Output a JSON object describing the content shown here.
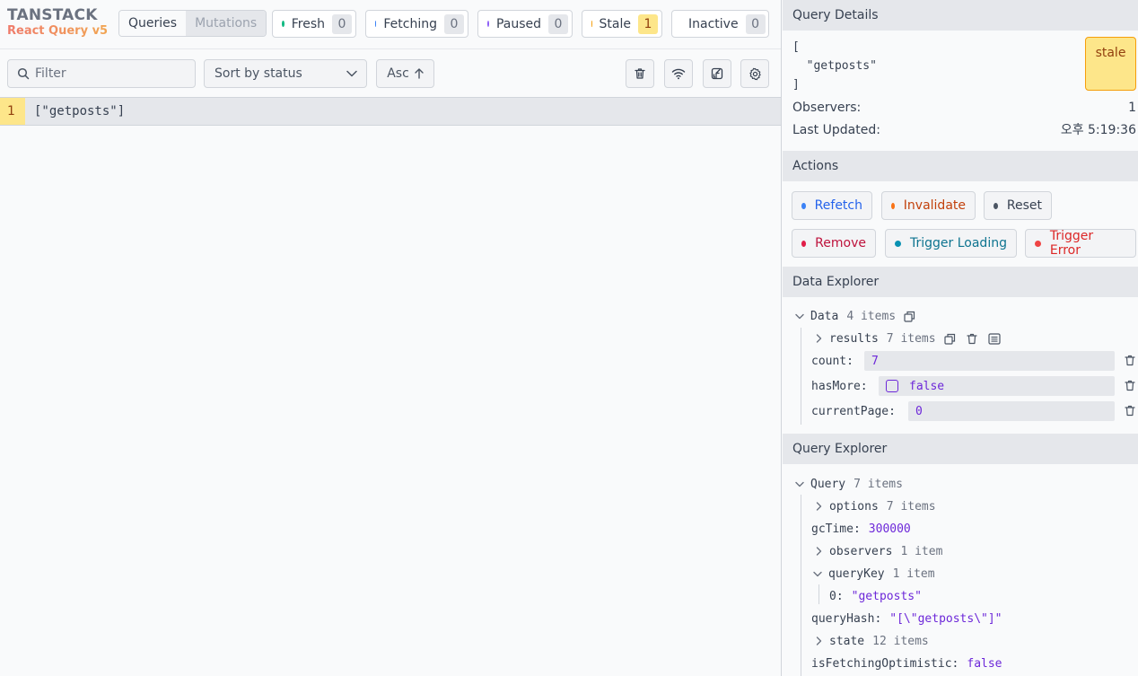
{
  "logo": {
    "line1": "TANSTACK",
    "line2": "React Query v5"
  },
  "tabs": {
    "queries": "Queries",
    "mutations": "Mutations"
  },
  "status_counts": [
    {
      "label": "Fresh",
      "count": "0",
      "color": "#10b981"
    },
    {
      "label": "Fetching",
      "count": "0",
      "color": "#3b82f6"
    },
    {
      "label": "Paused",
      "count": "0",
      "color": "#8b5cf6"
    },
    {
      "label": "Stale",
      "count": "1",
      "color": "#f59e0b"
    },
    {
      "label": "Inactive",
      "count": "0",
      "color": "#6b7280"
    }
  ],
  "filter": {
    "placeholder": "Filter"
  },
  "sort": {
    "selected": "Sort by status",
    "order": "Asc"
  },
  "toolbar_icons": [
    "trash-icon",
    "wifi-icon",
    "popout-icon",
    "gear-icon"
  ],
  "queries": [
    {
      "index": "1",
      "key": "[\"getposts\"]"
    }
  ],
  "query_details": {
    "title": "Query Details",
    "key_text": "[\n  \"getposts\"\n]",
    "status": "stale",
    "observers_label": "Observers:",
    "observers_value": "1",
    "updated_label": "Last Updated:",
    "updated_value": "오후 5:19:36"
  },
  "actions": {
    "title": "Actions",
    "buttons": [
      {
        "label": "Refetch",
        "color": "#3b82f6",
        "text_color": "#2563eb"
      },
      {
        "label": "Invalidate",
        "color": "#f97316",
        "text_color": "#c2410c"
      },
      {
        "label": "Reset",
        "color": "#4b5563",
        "text_color": "#374151"
      },
      {
        "label": "Remove",
        "color": "#e11d48",
        "text_color": "#be123c"
      },
      {
        "label": "Trigger Loading",
        "color": "#0891b2",
        "text_color": "#0e7490"
      },
      {
        "label": "Trigger Error",
        "color": "#ef4444",
        "text_color": "#dc2626"
      }
    ]
  },
  "data_explorer": {
    "title": "Data Explorer",
    "root": {
      "label": "Data",
      "meta": "4 items"
    },
    "results": {
      "label": "results",
      "meta": "7 items"
    },
    "fields": [
      {
        "key": "count:",
        "value": "7"
      },
      {
        "key": "hasMore:",
        "value": "false"
      },
      {
        "key": "currentPage:",
        "value": "0"
      }
    ]
  },
  "query_explorer": {
    "title": "Query Explorer",
    "root": {
      "label": "Query",
      "meta": "7 items"
    },
    "options": {
      "label": "options",
      "meta": "7 items"
    },
    "gcTime": {
      "key": "gcTime:",
      "value": "300000"
    },
    "observers": {
      "label": "observers",
      "meta": "1 item"
    },
    "queryKey": {
      "label": "queryKey",
      "meta": "1 item"
    },
    "queryKey_item": {
      "key": "0:",
      "value": "\"getposts\""
    },
    "queryHash": {
      "key": "queryHash:",
      "value": "\"[\\\"getposts\\\"]\""
    },
    "state": {
      "label": "state",
      "meta": "12 items"
    },
    "isFetchingOptimistic": {
      "key": "isFetchingOptimistic:",
      "value": "false"
    }
  }
}
